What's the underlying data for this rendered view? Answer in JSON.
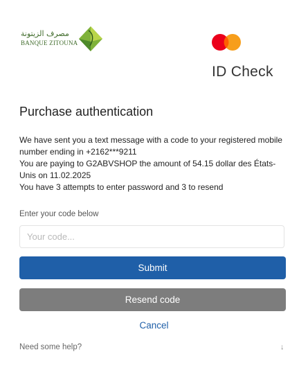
{
  "header": {
    "bank_name_ar": "مصرف الزيتونة",
    "bank_name_fr": "BANQUE ZITOUNA",
    "brand_title": "ID Check"
  },
  "colors": {
    "mastercard_red": "#eb001b",
    "mastercard_orange": "#f79e1b",
    "bank_green": "#3f6b2a",
    "primary_blue": "#1f5fa8",
    "secondary_gray": "#7d7d7d"
  },
  "main": {
    "title": "Purchase authentication",
    "message_lines": [
      "We have sent you a text message with a code to your registered mobile number ending in +2162***9211",
      "You are paying to G2ABVSHOP the amount of 54.15 dollar des États-Unis on 11.02.2025",
      "You have 3 attempts to enter password and 3 to resend"
    ]
  },
  "form": {
    "code_label": "Enter your code below",
    "code_placeholder": "Your code...",
    "submit_label": "Submit",
    "resend_label": "Resend code",
    "cancel_label": "Cancel"
  },
  "footer": {
    "help_label": "Need some help?",
    "help_arrow": "↓"
  }
}
